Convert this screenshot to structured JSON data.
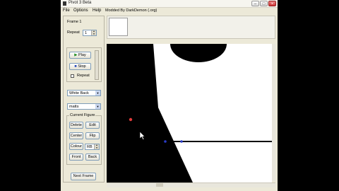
{
  "window": {
    "title": "Pivot 3 Beta",
    "controls": {
      "minimize": "–",
      "maximize": "□",
      "close": "×"
    }
  },
  "menu": {
    "items": [
      "File",
      "Options",
      "Help"
    ],
    "note": "Modded By DarkDemon (.org)"
  },
  "frame_panel": {
    "frame_label": "Frame 1",
    "repeat_label": "Repeat",
    "repeat_value": "1"
  },
  "playback": {
    "play_label": "Play",
    "stop_label": "Stop",
    "repeat_label": "Repeat",
    "play_icon": "play-triangle-icon",
    "stop_icon": "stop-square-icon"
  },
  "background_select": {
    "value": "White Back"
  },
  "figure_select": {
    "value": "matts"
  },
  "current_figure": {
    "group_label": "Current Figure",
    "buttons": [
      "Delete",
      "Edit",
      "Center",
      "Flip",
      "Colour",
      "Front",
      "Back"
    ],
    "colour_value": "RB"
  },
  "next_frame_label": "Next Frame",
  "colors": {
    "canvas_background": "#ffffff",
    "figure_fill": "#000000",
    "red_handle": "#e03a3a",
    "blue_handle": "#2a3cc8",
    "window_chrome": "#ece9d8"
  }
}
